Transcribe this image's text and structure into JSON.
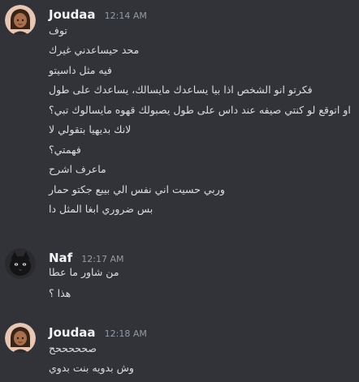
{
  "colors": {
    "background": "#313338",
    "text": "#dbdee1",
    "username": "#f2f3f5",
    "timestamp": "#949ba4"
  },
  "groups": [
    {
      "author": "Joudaa",
      "timestamp": "12:14 AM",
      "avatar": "avatar-girl-icon",
      "messages": [
        "توف",
        "محد حيساعدني غيرك",
        "فيه مثل داسيتو",
        "فكرتو انو الشخص اذا بيا يساعدك مايسالك، يساعدك على طول",
        "او اتوقع لو كنتي صيفه عند داس على طول يصبولك قهوه مايسالوك تبي؟",
        "لانك بديهيا بتقولي لا",
        "فهمتي؟",
        "ماعرف اشرح",
        "وربي حسيت اني نفس الي بيبع جكتو حمار",
        "بس ضروري ابغا المثل دا"
      ]
    },
    {
      "author": "Naf",
      "timestamp": "12:17 AM",
      "avatar": "avatar-cat-icon",
      "messages": [
        "من شاور ما عطا",
        "هذا ؟"
      ]
    },
    {
      "author": "Joudaa",
      "timestamp": "12:18 AM",
      "avatar": "avatar-girl-icon",
      "messages": [
        "صحححححح",
        "وش بدويه بنت بدوي"
      ]
    }
  ]
}
